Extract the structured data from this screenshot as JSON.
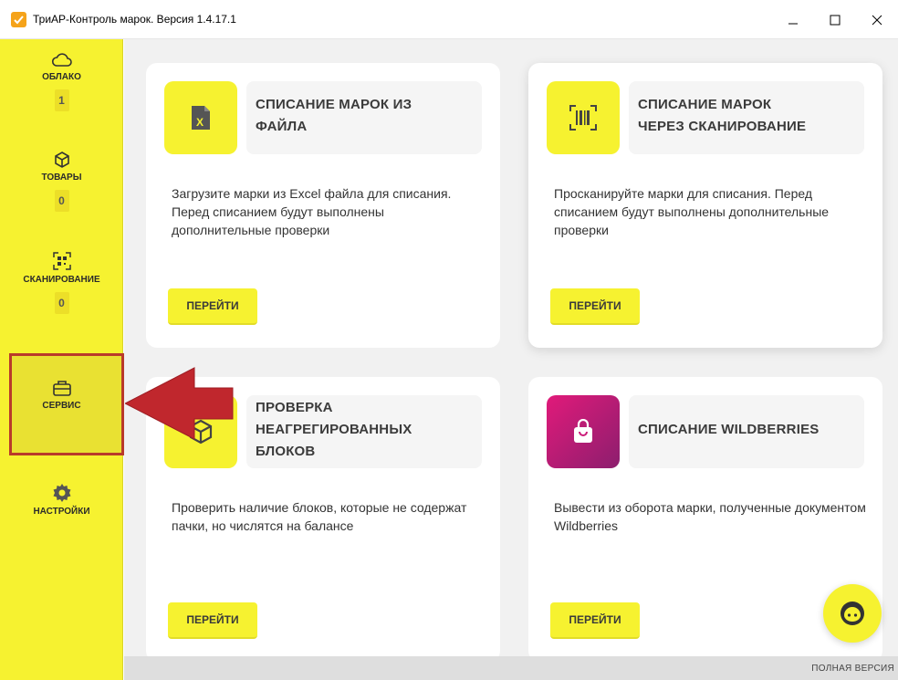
{
  "window": {
    "title": "ТриАР-Контроль марок. Версия 1.4.17.1"
  },
  "sidebar": {
    "items": [
      {
        "label": "ОБЛАКО",
        "count": "1",
        "icon": "cloud-icon"
      },
      {
        "label": "ТОВАРЫ",
        "count": "0",
        "icon": "box-icon"
      },
      {
        "label": "СКАНИРОВАНИЕ",
        "count": "0",
        "icon": "qr-scan-icon"
      },
      {
        "label": "СЕРВИС",
        "icon": "toolbox-icon"
      },
      {
        "label": "НАСТРОЙКИ",
        "icon": "gear-icon"
      }
    ],
    "active": "СЕРВИС"
  },
  "cards": [
    {
      "title_lines": [
        "СПИСАНИЕ МАРОК ИЗ",
        "ФАЙЛА"
      ],
      "description": "Загрузите марки из Excel файла для списания. Перед списанием будут выполнены дополнительные проверки",
      "button": "ПЕРЕЙТИ",
      "icon": "excel-file-icon"
    },
    {
      "title_lines": [
        "СПИСАНИЕ МАРОК",
        "ЧЕРЕЗ СКАНИРОВАНИЕ"
      ],
      "description": "Просканируйте марки для списания. Перед списанием будут выполнены дополнительные проверки",
      "button": "ПЕРЕЙТИ",
      "icon": "barcode-scan-icon"
    },
    {
      "title_lines": [
        "ПРОВЕРКА",
        "НЕАГРЕГИРОВАННЫХ",
        "БЛОКОВ"
      ],
      "description": "Проверить наличие блоков, которые не содержат пачки, но числятся на балансе",
      "button": "ПЕРЕЙТИ",
      "icon": "box-icon"
    },
    {
      "title_lines": [
        "СПИСАНИЕ WILDBERRIES"
      ],
      "description": "Вывести из оборота марки, полученные документом Wildberries",
      "button": "ПЕРЕЙТИ",
      "icon": "shopping-bag-icon"
    }
  ],
  "status_bar": {
    "text": "ПОЛНАЯ ВЕРСИЯ"
  },
  "colors": {
    "accent": "#f6f230",
    "highlight_border": "#b93a2a",
    "arrow": "#c0272d",
    "wildberries": "#cb1b79"
  }
}
